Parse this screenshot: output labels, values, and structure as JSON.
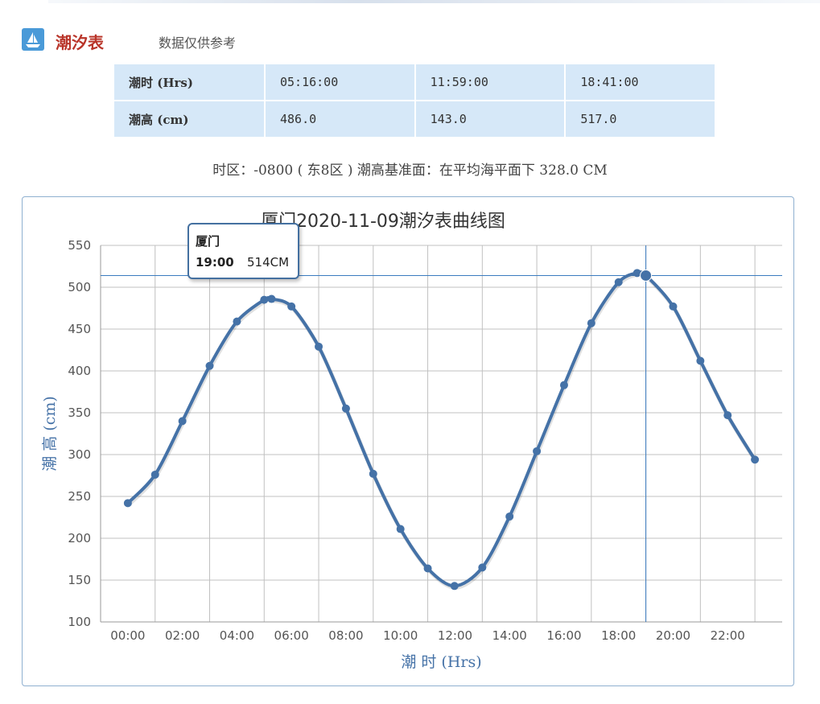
{
  "header": {
    "logo_icon": "boat-icon",
    "title": "潮汐表",
    "subtitle": "数据仅供参考"
  },
  "tide_table": {
    "rows": [
      {
        "label": "潮时 (Hrs)",
        "cells": [
          "05:16:00",
          "11:59:00",
          "18:41:00"
        ]
      },
      {
        "label": "潮高 (cm)",
        "cells": [
          "486.0",
          "143.0",
          "517.0"
        ]
      }
    ]
  },
  "info_line": "时区：-0800 ( 东8区 ) 潮高基准面：在平均海平面下 328.0 CM",
  "tooltip": {
    "name": "厦门",
    "time": "19:00",
    "value": "514CM"
  },
  "colors": {
    "series": "#4572a7",
    "crosshair": "#3a7bbf",
    "grid": "#c0c0c0",
    "axis_title": "#4572a7",
    "table_bg": "#d6e8f8",
    "title_red": "#b9352a"
  },
  "chart_data": {
    "type": "line",
    "title": "厦门2020-11-09潮汐表曲线图",
    "xlabel": "潮 时 (Hrs)",
    "ylabel": "潮 高 (cm)",
    "ylim": [
      100,
      550
    ],
    "yticks": [
      100,
      150,
      200,
      250,
      300,
      350,
      400,
      450,
      500,
      550
    ],
    "xlim": [
      -1,
      24
    ],
    "xticks": [
      {
        "x": 0,
        "label": "00:00"
      },
      {
        "x": 2,
        "label": "02:00"
      },
      {
        "x": 4,
        "label": "04:00"
      },
      {
        "x": 6,
        "label": "06:00"
      },
      {
        "x": 8,
        "label": "08:00"
      },
      {
        "x": 10,
        "label": "10:00"
      },
      {
        "x": 12,
        "label": "12:00"
      },
      {
        "x": 14,
        "label": "14:00"
      },
      {
        "x": 16,
        "label": "16:00"
      },
      {
        "x": 18,
        "label": "18:00"
      },
      {
        "x": 20,
        "label": "20:00"
      },
      {
        "x": 22,
        "label": "22:00"
      }
    ],
    "grid": true,
    "series": [
      {
        "name": "厦门",
        "points": [
          {
            "x": 0,
            "y": 242
          },
          {
            "x": 1,
            "y": 276
          },
          {
            "x": 2,
            "y": 340
          },
          {
            "x": 3,
            "y": 406
          },
          {
            "x": 4,
            "y": 459
          },
          {
            "x": 5,
            "y": 485
          },
          {
            "x": 5.27,
            "y": 486
          },
          {
            "x": 6,
            "y": 477
          },
          {
            "x": 7,
            "y": 429
          },
          {
            "x": 8,
            "y": 355
          },
          {
            "x": 9,
            "y": 277
          },
          {
            "x": 10,
            "y": 211
          },
          {
            "x": 11,
            "y": 164
          },
          {
            "x": 11.98,
            "y": 143
          },
          {
            "x": 13,
            "y": 165
          },
          {
            "x": 14,
            "y": 226
          },
          {
            "x": 15,
            "y": 304
          },
          {
            "x": 16,
            "y": 383
          },
          {
            "x": 17,
            "y": 457
          },
          {
            "x": 18,
            "y": 506
          },
          {
            "x": 18.68,
            "y": 517
          },
          {
            "x": 19,
            "y": 514
          },
          {
            "x": 20,
            "y": 477
          },
          {
            "x": 21,
            "y": 412
          },
          {
            "x": 22,
            "y": 347
          },
          {
            "x": 23,
            "y": 294
          }
        ]
      }
    ],
    "highlight": {
      "x": 19,
      "y": 514
    }
  }
}
